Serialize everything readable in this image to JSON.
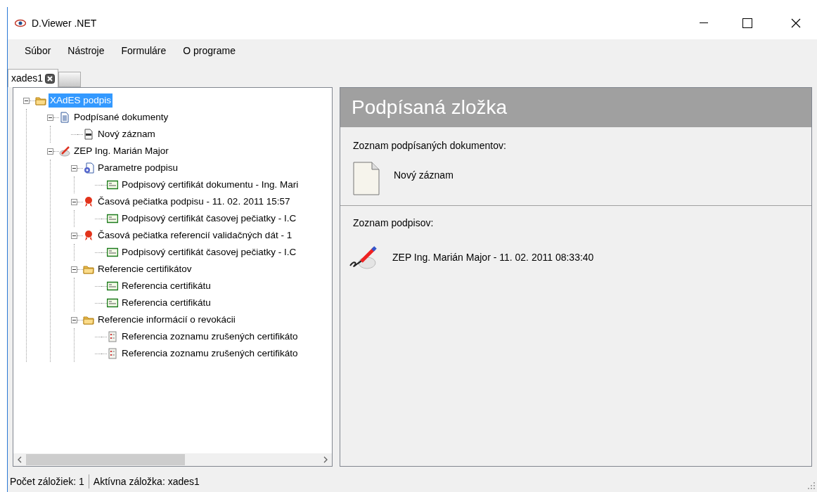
{
  "window": {
    "title": "D.Viewer .NET"
  },
  "menu": [
    "Súbor",
    "Nástroje",
    "Formuláre",
    "O programe"
  ],
  "tabs": [
    {
      "label": "xades1",
      "selected": true
    }
  ],
  "tree": [
    {
      "label": "XAdES podpis",
      "kind": "folder",
      "selected": true,
      "expanded": true,
      "children": [
        {
          "label": "Podpísané dokumenty",
          "kind": "document",
          "selected": false,
          "expanded": true,
          "children": [
            {
              "label": "Nový záznam",
              "kind": "xml",
              "selected": false
            }
          ]
        },
        {
          "label": "ZEP Ing. Marián Major",
          "kind": "signature",
          "selected": false,
          "expanded": true,
          "children": [
            {
              "label": "Parametre podpisu",
              "kind": "parameters",
              "selected": false,
              "expanded": true,
              "children": [
                {
                  "label": "Podpisový certifikát dokumentu - Ing. Mari",
                  "kind": "certificate",
                  "selected": false
                }
              ]
            },
            {
              "label": "Časová pečiatka podpisu - 11. 02. 2011 15:57",
              "kind": "seal",
              "selected": false,
              "expanded": true,
              "children": [
                {
                  "label": "Podpisový certifikát časovej pečiatky - I.C",
                  "kind": "certificate",
                  "selected": false
                }
              ]
            },
            {
              "label": "Časová pečiatka referencií validačných dát - 1",
              "kind": "seal",
              "selected": false,
              "expanded": true,
              "children": [
                {
                  "label": "Podpisový certifikát časovej pečiatky - I.C",
                  "kind": "certificate",
                  "selected": false
                }
              ]
            },
            {
              "label": "Referencie certifikátov",
              "kind": "folder",
              "selected": false,
              "expanded": true,
              "children": [
                {
                  "label": "Referencia certifikátu",
                  "kind": "certificate",
                  "selected": false
                },
                {
                  "label": "Referencia certifikátu",
                  "kind": "certificate",
                  "selected": false
                }
              ]
            },
            {
              "label": "Referencie informácií o revokácii",
              "kind": "folder",
              "selected": false,
              "expanded": true,
              "children": [
                {
                  "label": "Referencia zoznamu zrušených certifikáto",
                  "kind": "revocation",
                  "selected": false
                },
                {
                  "label": "Referencia zoznamu zrušených certifikáto",
                  "kind": "revocation",
                  "selected": false
                }
              ]
            }
          ]
        }
      ]
    }
  ],
  "detail": {
    "title": "Podpísaná zložka",
    "documents_label": "Zoznam podpísaných dokumentov:",
    "documents": [
      "Nový záznam"
    ],
    "signatures_label": "Zoznam podpisov:",
    "signatures": [
      "ZEP Ing. Marián Major - 11. 02. 2011 08:33:40"
    ]
  },
  "status_bar": [
    "Počet záložiek: 1",
    "Aktívna záložka: xades1"
  ]
}
